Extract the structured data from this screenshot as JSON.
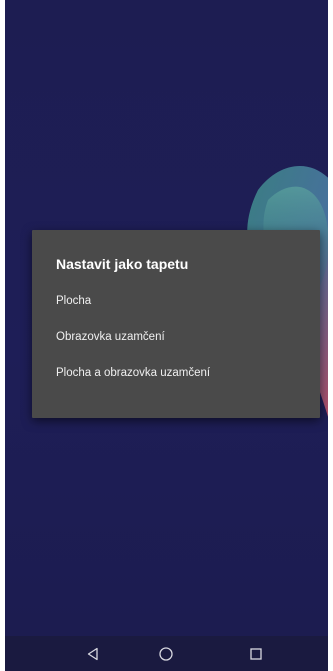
{
  "dialog": {
    "title": "Nastavit jako tapetu",
    "options": [
      {
        "label": "Plocha"
      },
      {
        "label": "Obrazovka uzamčení"
      },
      {
        "label": "Plocha a obrazovka uzamčení"
      }
    ]
  },
  "navigation": {
    "buttons": [
      {
        "icon": "back-triangle-icon"
      },
      {
        "icon": "home-circle-icon"
      },
      {
        "icon": "recents-square-icon"
      }
    ]
  },
  "colors": {
    "wallpaper_background": "#1e1e57",
    "dialog_background": "#4a4a4a",
    "navbar_background": "#1a1a40"
  }
}
